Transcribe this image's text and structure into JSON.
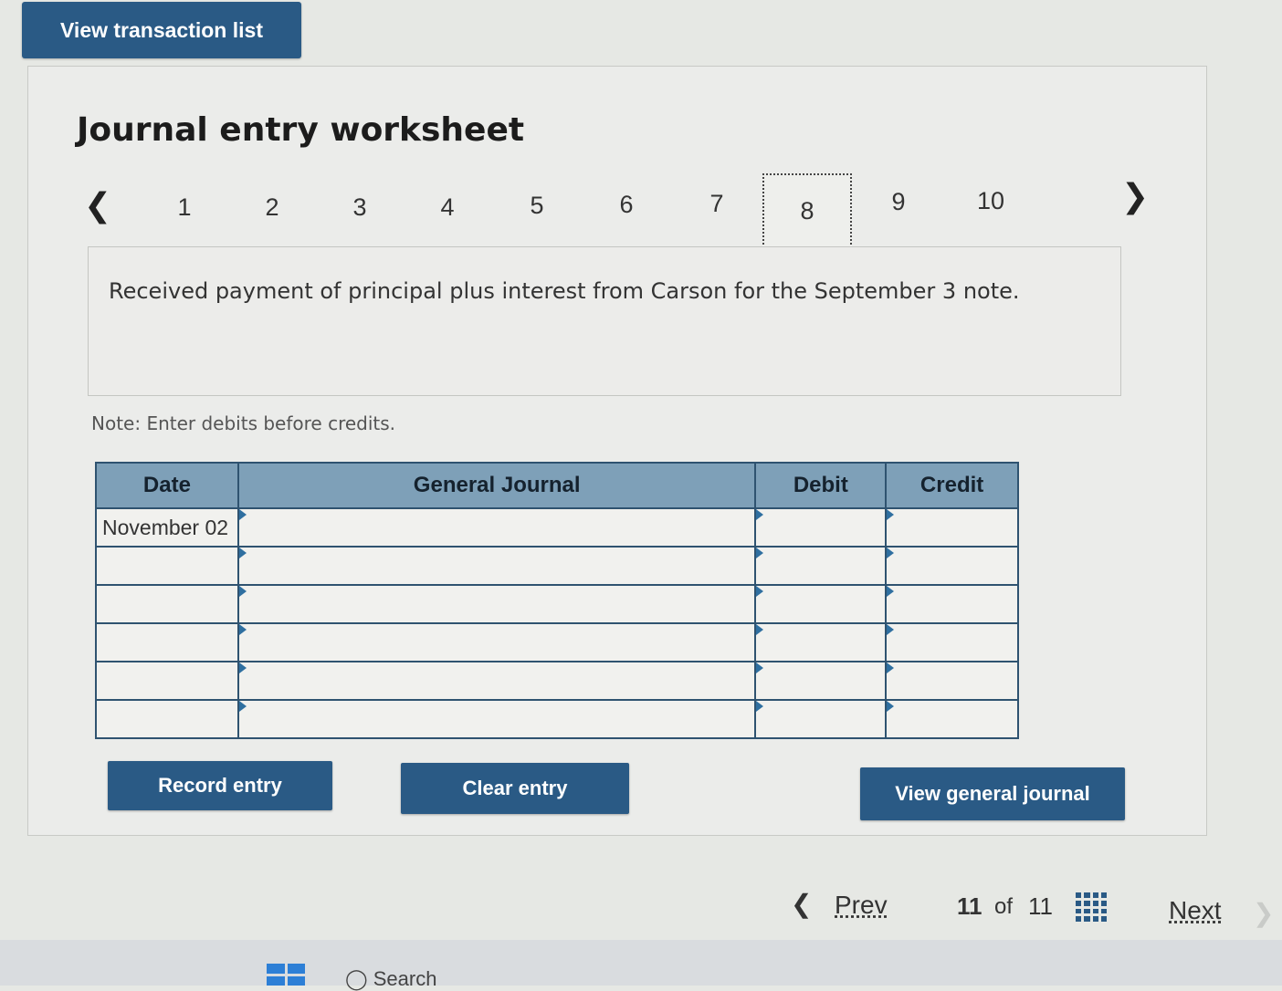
{
  "top_button": {
    "label": "View transaction list"
  },
  "worksheet": {
    "title": "Journal entry worksheet",
    "pager": {
      "prev_icon": "chevron-left-icon",
      "next_icon": "chevron-right-icon",
      "tabs": [
        "1",
        "2",
        "3",
        "4",
        "5",
        "6",
        "7",
        "8",
        "9",
        "10"
      ],
      "active_tab": "8"
    },
    "description": "Received payment of principal plus interest from Carson for the September 3 note.",
    "note": "Note: Enter debits before credits."
  },
  "journal": {
    "columns": [
      "Date",
      "General Journal",
      "Debit",
      "Credit"
    ],
    "rows": [
      {
        "date": "November 02",
        "account": "",
        "debit": "",
        "credit": ""
      },
      {
        "date": "",
        "account": "",
        "debit": "",
        "credit": ""
      },
      {
        "date": "",
        "account": "",
        "debit": "",
        "credit": ""
      },
      {
        "date": "",
        "account": "",
        "debit": "",
        "credit": ""
      },
      {
        "date": "",
        "account": "",
        "debit": "",
        "credit": ""
      },
      {
        "date": "",
        "account": "",
        "debit": "",
        "credit": ""
      }
    ]
  },
  "buttons": {
    "record": "Record entry",
    "clear": "Clear entry",
    "view_journal": "View general journal"
  },
  "footer": {
    "prev": "Prev",
    "current": "11",
    "of": "of",
    "total": "11",
    "next": "Next"
  },
  "taskbar": {
    "search": "Search"
  },
  "colors": {
    "button_blue": "#2a5a85",
    "header_blue": "#7ea0b8"
  }
}
